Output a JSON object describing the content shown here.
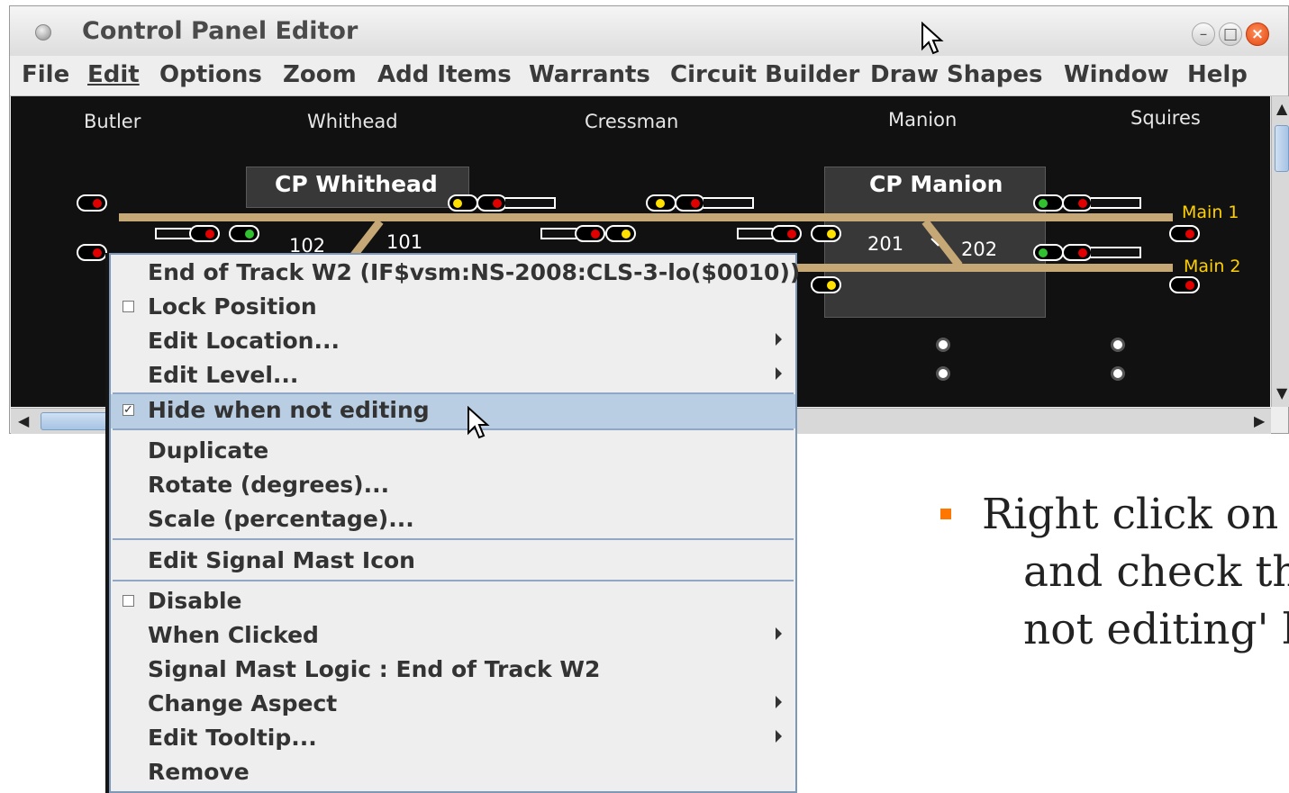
{
  "window": {
    "title": "Control Panel Editor",
    "controls": {
      "minimize": "–",
      "maximize": "□",
      "close": "×"
    }
  },
  "menubar": {
    "items": [
      "File",
      "Edit",
      "Options",
      "Zoom",
      "Add Items",
      "Warrants",
      "Circuit Builder",
      "Draw Shapes",
      "Window",
      "Help"
    ]
  },
  "panel": {
    "stations": [
      "Butler",
      "Whithead",
      "Cressman",
      "Manion",
      "Squires"
    ],
    "control_points": [
      "CP Whithead",
      "CP Manion"
    ],
    "tracks": [
      "Main 1",
      "Main 2"
    ],
    "switches": [
      "102",
      "101",
      "201",
      "202"
    ]
  },
  "context_menu": {
    "items": [
      {
        "label": "End of Track W2 (IF$vsm:NS-2008:CLS-3-lo($0010))"
      },
      {
        "label": "Lock Position",
        "checkbox": "unchecked"
      },
      {
        "label": "Edit Location...",
        "submenu": true
      },
      {
        "label": "Edit Level...",
        "submenu": true
      },
      {
        "label": "Hide when not editing",
        "checkbox": "checked",
        "highlighted": true
      },
      {
        "label": "Duplicate"
      },
      {
        "label": "Rotate (degrees)..."
      },
      {
        "label": "Scale (percentage)..."
      },
      {
        "label": "Edit Signal Mast Icon"
      },
      {
        "label": "Disable",
        "checkbox": "unchecked"
      },
      {
        "label": "When Clicked",
        "submenu": true
      },
      {
        "label": "Signal Mast Logic : End of Track W2"
      },
      {
        "label": "Change Aspect",
        "submenu": true
      },
      {
        "label": "Edit Tooltip...",
        "submenu": true
      },
      {
        "label": "Remove"
      }
    ]
  },
  "note": {
    "lines": [
      "Right click on e",
      "and check the",
      "not editing' bo"
    ]
  },
  "colors": {
    "panel_background": "#111111",
    "track": "#c6a876",
    "track_label": "#ffd000",
    "menu_highlight": "#b9cde3",
    "bullet": "#ff7700"
  }
}
